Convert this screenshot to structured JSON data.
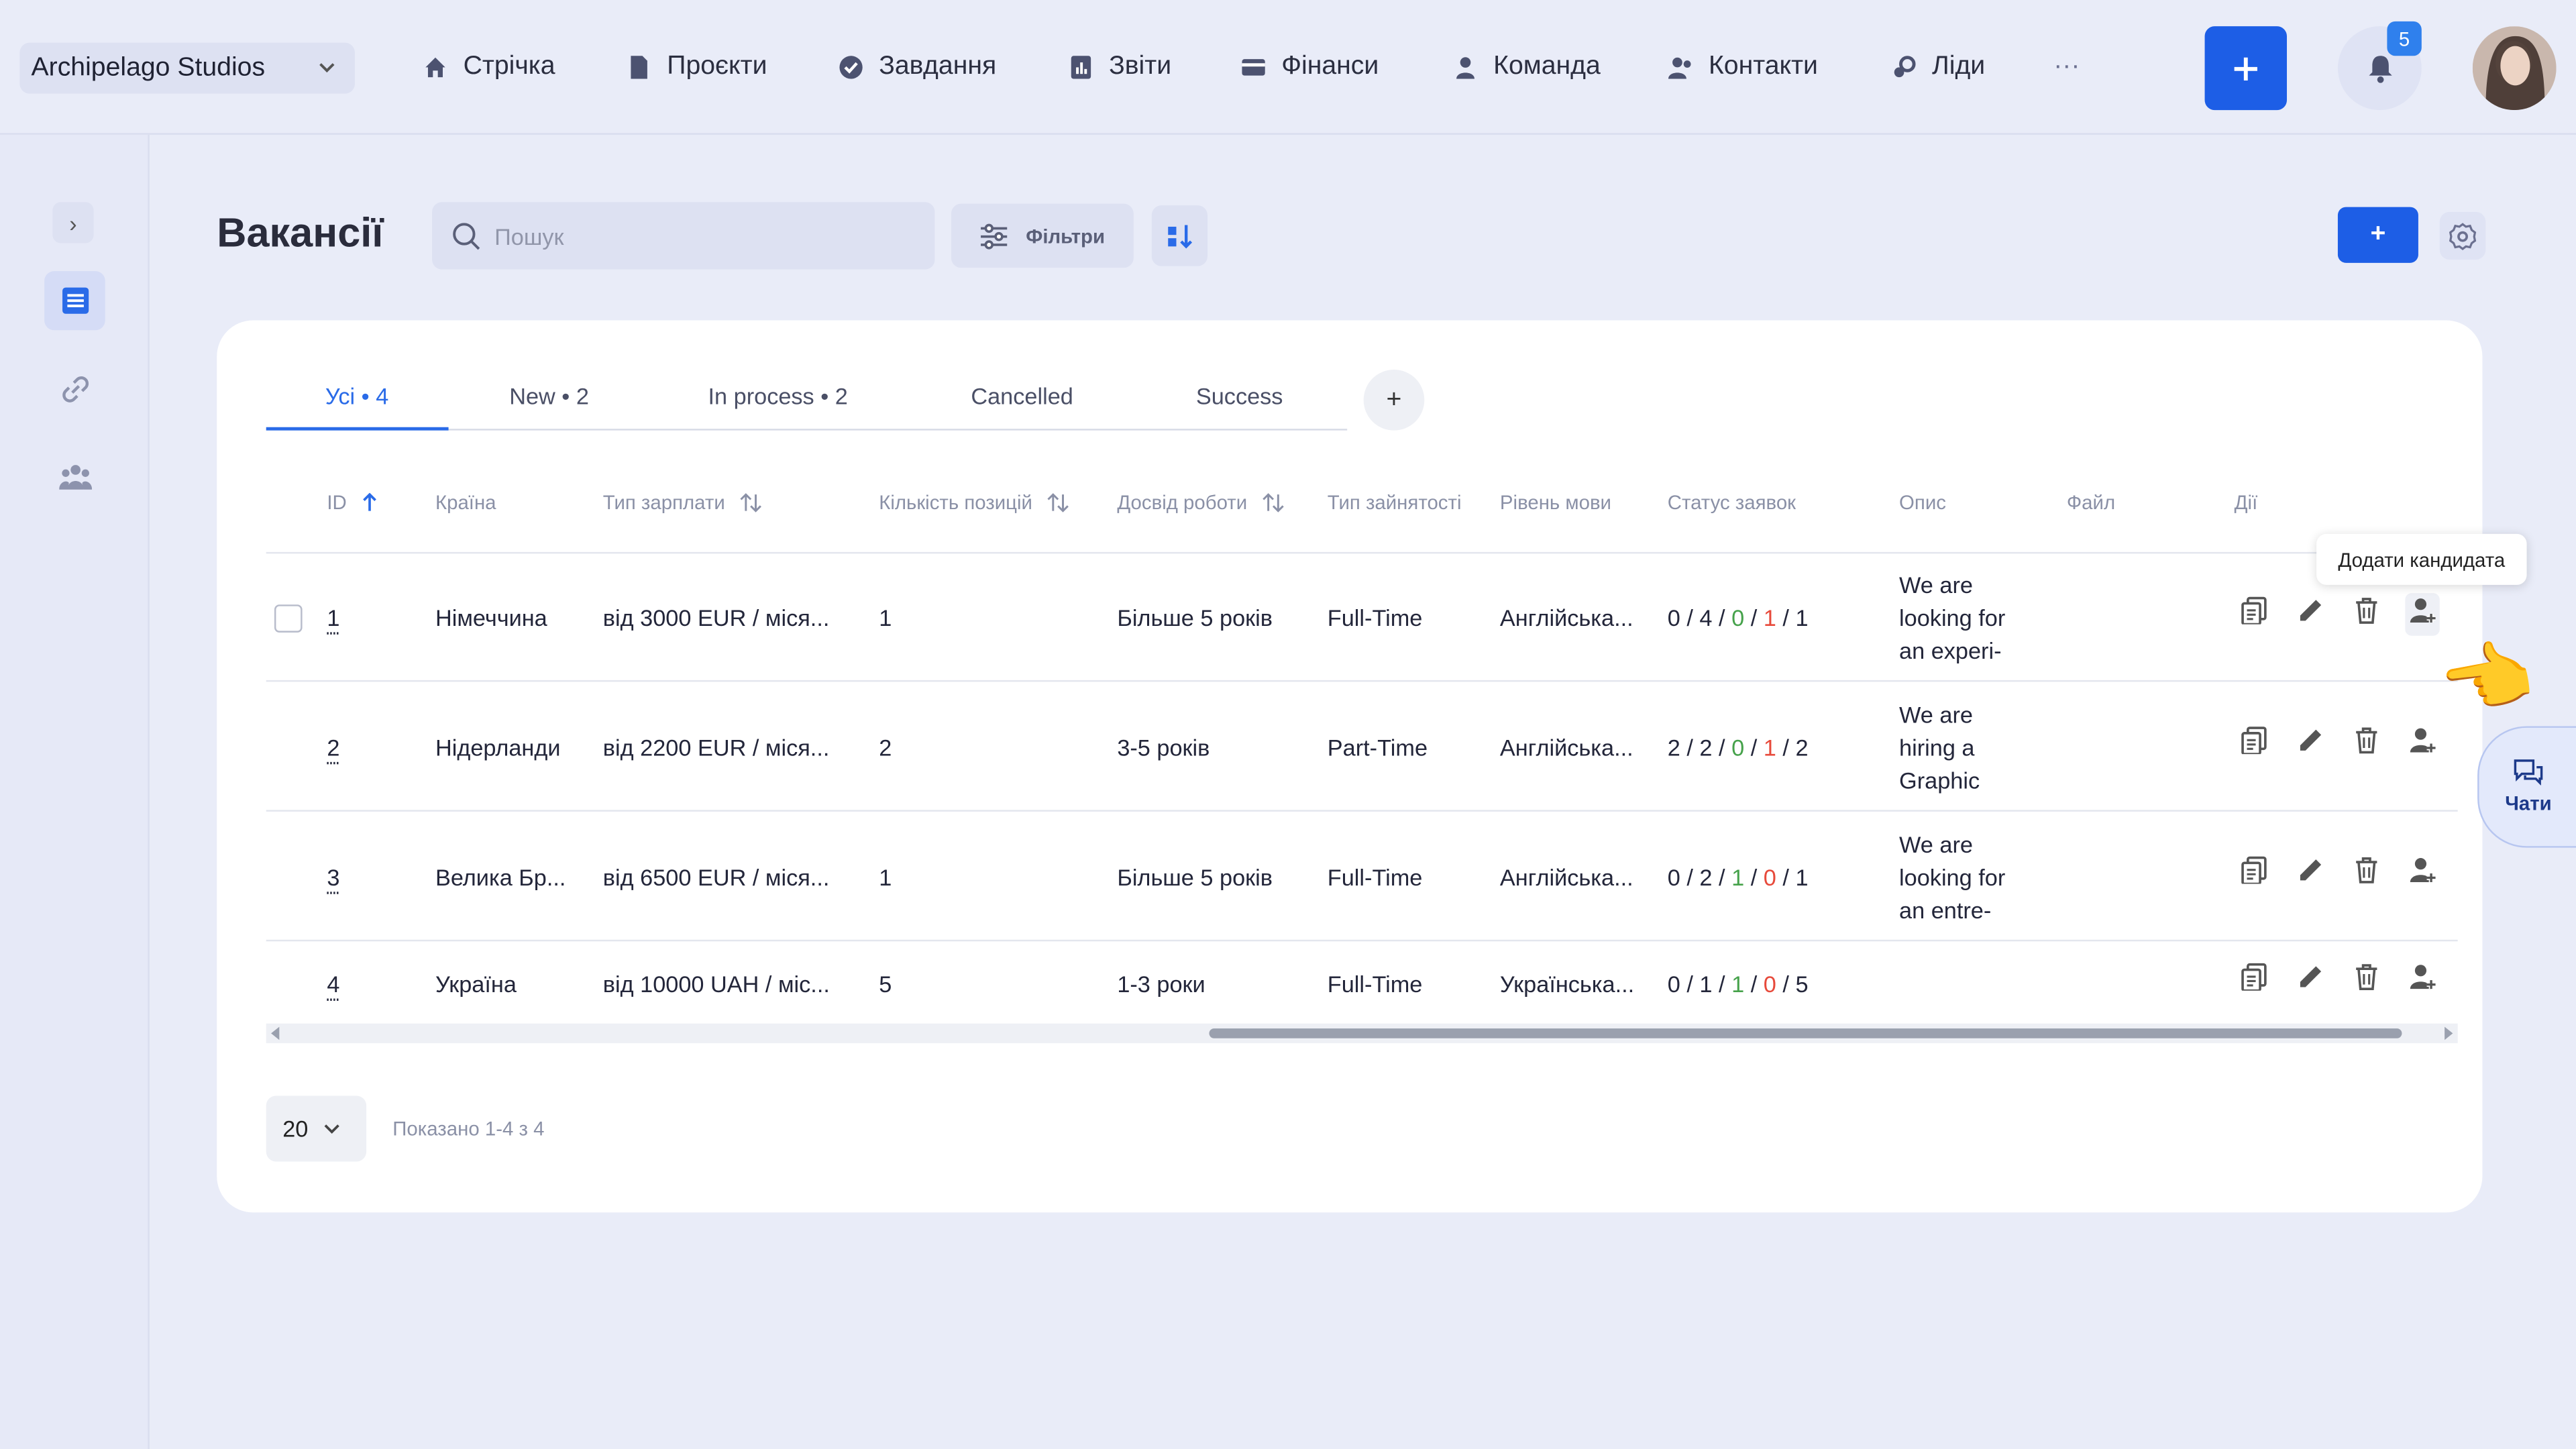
{
  "header": {
    "company": "Archipelago Studios",
    "nav": [
      "Стрічка",
      "Проєкти",
      "Завдання",
      "Звіти",
      "Фінанси",
      "Команда",
      "Контакти",
      "Ліди"
    ],
    "more": "···",
    "add_label": "+",
    "notification_count": "5"
  },
  "sidebar": {
    "toggle": "›",
    "icons": [
      "document-icon",
      "link-icon",
      "team-icon"
    ]
  },
  "page": {
    "title": "Вакансії",
    "search_placeholder": "Пошук",
    "filters_label": "Фільтри",
    "add_label": "+"
  },
  "tabs": [
    {
      "label": "Усі • 4",
      "active": true
    },
    {
      "label": "New • 2"
    },
    {
      "label": "In process • 2"
    },
    {
      "label": "Cancelled"
    },
    {
      "label": "Success"
    }
  ],
  "tab_add": "+",
  "columns": [
    "ID",
    "Країна",
    "Тип зарплати",
    "Кількість позицій",
    "Досвід роботи",
    "Тип зайнятості",
    "Рівень мови",
    "Статус заявок",
    "Опис",
    "Файл",
    "Дії"
  ],
  "rows": [
    {
      "id": "1",
      "country": "Німеччина",
      "salary": "від 3000 EUR / міся...",
      "positions": "1",
      "experience": "Більше 5 років",
      "employment": "Full-Time",
      "language": "Англійська...",
      "status": [
        "0",
        "4",
        "0",
        "1",
        "1"
      ],
      "desc": [
        "We are",
        "looking for",
        "an experi-"
      ]
    },
    {
      "id": "2",
      "country": "Нідерланди",
      "salary": "від 2200 EUR / міся...",
      "positions": "2",
      "experience": "3-5 років",
      "employment": "Part-Time",
      "language": "Англійська...",
      "status": [
        "2",
        "2",
        "0",
        "1",
        "2"
      ],
      "desc": [
        "We are",
        "hiring a",
        "Graphic"
      ]
    },
    {
      "id": "3",
      "country": "Велика Бр...",
      "salary": "від 6500 EUR / міся...",
      "positions": "1",
      "experience": "Більше 5 років",
      "employment": "Full-Time",
      "language": "Англійська...",
      "status": [
        "0",
        "2",
        "1",
        "0",
        "1"
      ],
      "desc": [
        "We are",
        "looking for",
        "an entre-"
      ]
    },
    {
      "id": "4",
      "country": "Україна",
      "salary": "від 10000 UAH / міс...",
      "positions": "5",
      "experience": "1-3 роки",
      "employment": "Full-Time",
      "language": "Українська...",
      "status": [
        "0",
        "1",
        "1",
        "0",
        "5"
      ],
      "desc": []
    }
  ],
  "tooltip": "Додати кандидата",
  "pagination": {
    "per_page": "20",
    "shown": "Показано 1-4 з 4"
  },
  "chats_label": "Чати",
  "colors": {
    "accent": "#1d5ee6",
    "green": "#46a24b",
    "red": "#e74a3b"
  }
}
